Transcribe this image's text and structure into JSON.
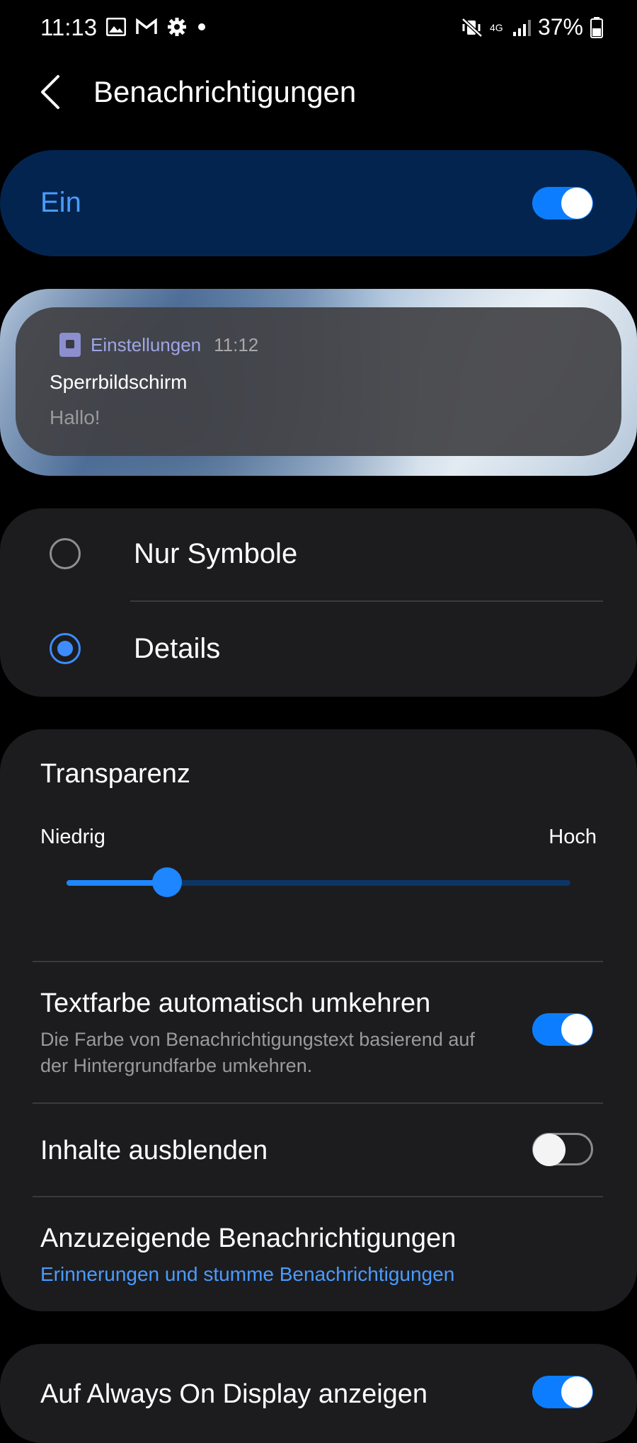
{
  "status_bar": {
    "time": "11:13",
    "network": "4G",
    "battery": "37%",
    "icons": [
      "image-icon",
      "gmail-icon",
      "settings-gear-icon",
      "dot-icon",
      "mute-vibrate-icon",
      "network-4g-icon",
      "signal-icon",
      "battery-icon"
    ]
  },
  "header": {
    "title": "Benachrichtigungen",
    "back_icon": "back-chevron-icon"
  },
  "master_toggle": {
    "label": "Ein",
    "on": true
  },
  "preview": {
    "app_name": "Einstellungen",
    "time": "11:12",
    "title": "Sperrbildschirm",
    "body": "Hallo!"
  },
  "style_options": {
    "items": [
      {
        "label": "Nur Symbole",
        "selected": false
      },
      {
        "label": "Details",
        "selected": true
      }
    ]
  },
  "transparency": {
    "title": "Transparenz",
    "low_label": "Niedrig",
    "high_label": "Hoch",
    "value_fraction": 0.2
  },
  "settings": {
    "invert_text": {
      "title": "Textfarbe automatisch umkehren",
      "subtitle": "Die Farbe von Benachrichtigungstext basierend auf der Hintergrundfarbe umkehren.",
      "on": true
    },
    "hide_content": {
      "title": "Inhalte ausblenden",
      "on": false
    },
    "notifications_to_show": {
      "title": "Anzuzeigende Benachrichtigungen",
      "value": "Erinnerungen und stumme Benachrichtigungen"
    },
    "always_on_display": {
      "title": "Auf Always On Display anzeigen",
      "on": true
    }
  },
  "colors": {
    "accent": "#0d7dff",
    "accent_text": "#4a9bff",
    "card": "#1c1c1e",
    "master_bg": "#03244f"
  }
}
